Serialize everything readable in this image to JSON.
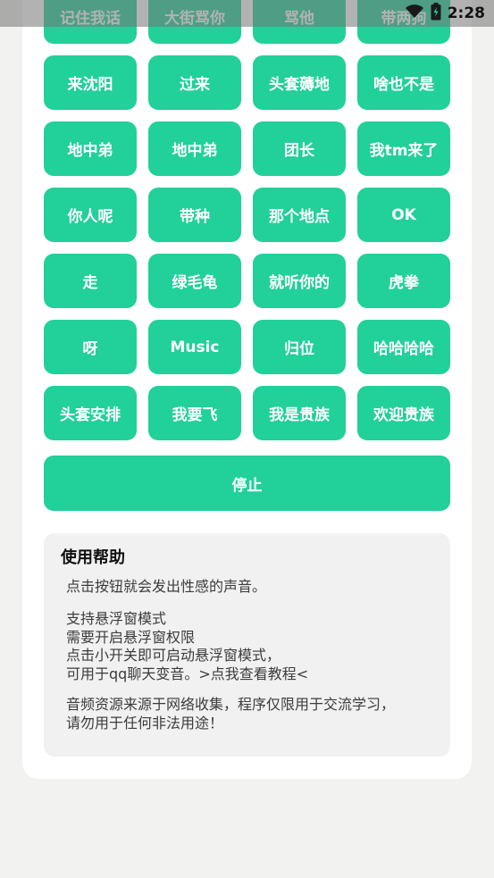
{
  "status_bar": {
    "time": "2:28",
    "icons": [
      "wifi-icon",
      "battery-charging-icon"
    ]
  },
  "sound_buttons": [
    "记住我话",
    "大街骂你",
    "骂他",
    "带两狗",
    "来沈阳",
    "过来",
    "头套薅地",
    "啥也不是",
    "地中弟",
    "地中弟",
    "团长",
    "我tm来了",
    "你人呢",
    "带种",
    "那个地点",
    "OK",
    "走",
    "绿毛龟",
    "就听你的",
    "虎拳",
    "呀",
    "Music",
    "归位",
    "哈哈哈哈",
    "头套安排",
    "我要飞",
    "我是贵族",
    "欢迎贵族"
  ],
  "stop_label": "停止",
  "help": {
    "title": "使用帮助",
    "p1": "点击按钮就会发出性感的声音。",
    "p2": "支持悬浮窗模式\n需要开启悬浮窗权限\n点击小开关即可启动悬浮窗模式，\n可用于qq聊天变音。>点我查看教程<",
    "p3": "音频资源来源于网络收集，程序仅限用于交流学习，\n请勿用于任何非法用途！"
  },
  "colors": {
    "accent": "#22d09a",
    "background": "#f2f2f0",
    "help_bg": "#f1f1f1"
  }
}
